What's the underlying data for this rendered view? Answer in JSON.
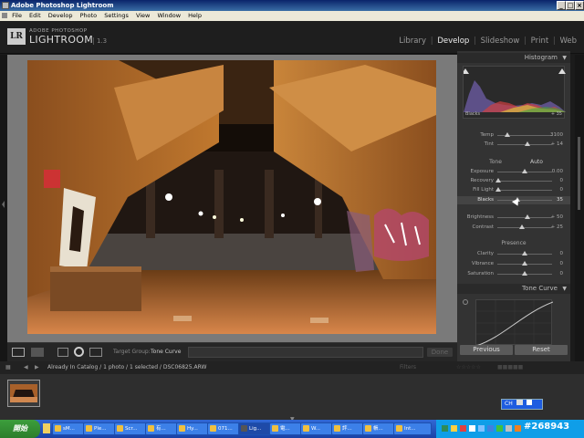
{
  "window": {
    "title": "Adobe Photoshop Lightroom",
    "controls": {
      "minimize": "_",
      "maximize": "□",
      "close": "×"
    }
  },
  "menu": [
    "File",
    "Edit",
    "Develop",
    "Photo",
    "Settings",
    "View",
    "Window",
    "Help"
  ],
  "header": {
    "logo": "LR",
    "brand_small": "ADOBE PHOTOSHOP",
    "brand_big": "LIGHTROOM",
    "version": "1.3",
    "modules": [
      "Library",
      "Develop",
      "Slideshow",
      "Print",
      "Web"
    ],
    "active_module": "Develop",
    "separator": "|"
  },
  "histogram": {
    "title": "Histogram",
    "left_label": "Blacks",
    "right_label": "+ 35"
  },
  "basic": {
    "white_balance": [
      {
        "label": "Temp",
        "value": "3100",
        "pos": 0.18
      },
      {
        "label": "Tint",
        "value": "+ 14",
        "pos": 0.55
      }
    ],
    "tone_label": "Tone",
    "auto_label": "Auto",
    "tone": [
      {
        "label": "Exposure",
        "value": "0.00",
        "pos": 0.5
      },
      {
        "label": "Recovery",
        "value": "0",
        "pos": 0.0
      },
      {
        "label": "Fill Light",
        "value": "0",
        "pos": 0.0
      },
      {
        "label": "Blacks",
        "value": "35",
        "pos": 0.36
      },
      {
        "label": "Brightness",
        "value": "+ 50",
        "pos": 0.55
      },
      {
        "label": "Contrast",
        "value": "+ 25",
        "pos": 0.45
      }
    ],
    "presence_label": "Presence",
    "presence": [
      {
        "label": "Clarity",
        "value": "0",
        "pos": 0.5
      },
      {
        "label": "Vibrance",
        "value": "0",
        "pos": 0.5
      },
      {
        "label": "Saturation",
        "value": "0",
        "pos": 0.5
      }
    ]
  },
  "tone_curve": {
    "title": "Tone Curve"
  },
  "buttons": {
    "previous": "Previous",
    "reset": "Reset",
    "done": "Done"
  },
  "toolbar": {
    "target_group_label": "Target Group:",
    "target_group_value": "Tone Curve"
  },
  "filmstrip_bar": {
    "info": "Already In Catalog / 1 photo / 1 selected / DSC06825.ARW",
    "filter_label": "Filters"
  },
  "ime": {
    "label": "CH"
  },
  "taskbar": {
    "start": "開始",
    "tasks": [
      "sM...",
      "Ple...",
      "Scr...",
      "有...",
      "Hy...",
      "071...",
      "Lig...",
      "電...",
      "W...",
      "評...",
      "帳...",
      "Int..."
    ],
    "active_index": 6
  },
  "watermark": "#268943",
  "colors": {
    "panel_bg": "#333333",
    "accent": "#cccccc",
    "photo_warm": "#c67a2e"
  }
}
